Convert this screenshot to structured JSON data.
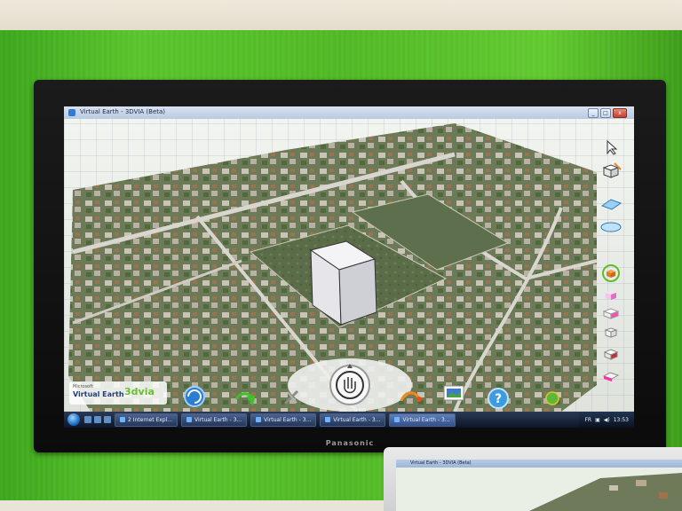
{
  "window": {
    "title": "Virtual Earth - 3DVIA (Beta)",
    "buttons": [
      "_",
      "□",
      "x"
    ]
  },
  "logo": {
    "microsoft": "Microsoft",
    "virtual_earth": "Virtual Earth",
    "threedvia": "3dvia"
  },
  "tv_brand": "Panasonic",
  "taskbar": {
    "items": [
      "2 Internet Expl...",
      "Virtual Earth - 3...",
      "Virtual Earth - 3...",
      "Virtual Earth - 3...",
      "Virtual Earth - 3..."
    ],
    "language": "FR",
    "clock": "13:53"
  },
  "second_monitor": {
    "title": "Virtual Earth - 3DVIA (Beta)"
  },
  "tool_icons": [
    "cursor-icon",
    "edit-cube-icon",
    "rectangle-icon",
    "ellipse-icon",
    "cube-icon",
    "paint-icon",
    "box-pink-icon",
    "box-white-icon",
    "box-red-icon",
    "box-magenta-icon"
  ],
  "colors": {
    "accent": "#2f7bd6",
    "brand_green": "#6abf2f"
  }
}
